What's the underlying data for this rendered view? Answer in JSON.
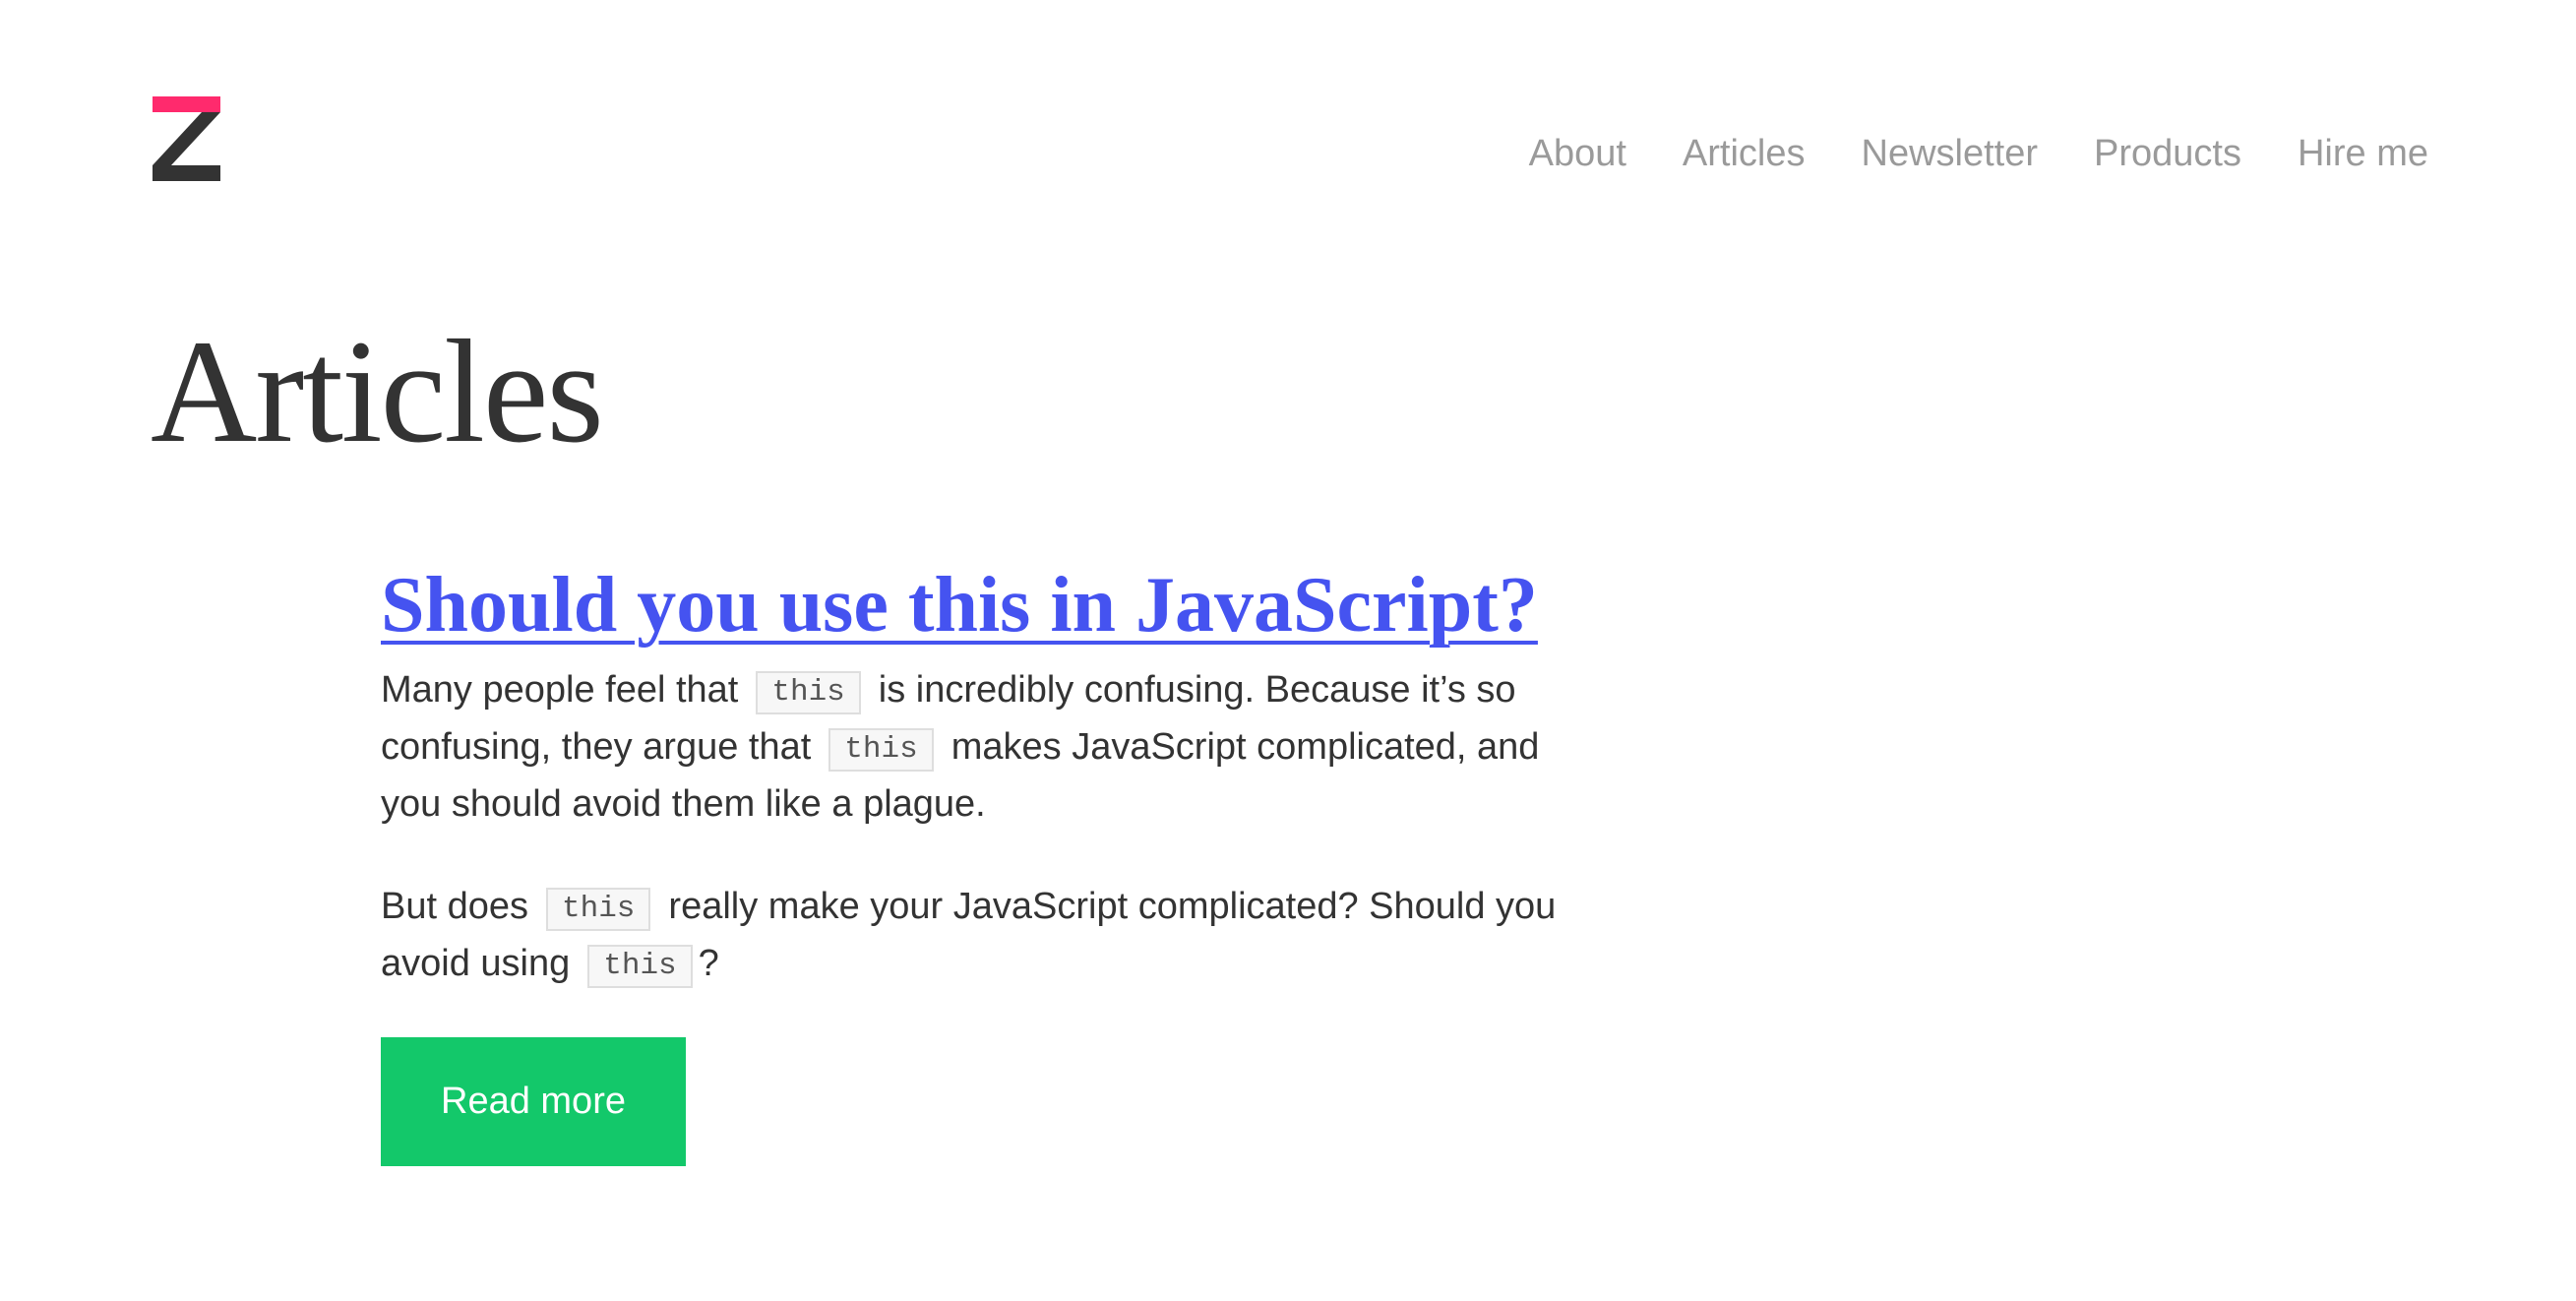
{
  "brand": {
    "logo_icon": "z-logo-icon",
    "logo_accent_color": "#ff2a6d",
    "logo_color": "#333333"
  },
  "nav": {
    "items": [
      {
        "label": "About"
      },
      {
        "label": "Articles"
      },
      {
        "label": "Newsletter"
      },
      {
        "label": "Products"
      },
      {
        "label": "Hire me"
      }
    ],
    "color": "#9a9a9a"
  },
  "page": {
    "title": "Articles"
  },
  "articles": [
    {
      "title": "Should you use this in JavaScript?",
      "title_color": "#4553f0",
      "excerpt_1": {
        "a": "Many people feel that",
        "code_1": "this",
        "b": "is incredibly confusing. Because it’s so",
        "c": "confusing, they argue that",
        "code_2": "this",
        "d": "makes JavaScript complicated, and",
        "e": "you should avoid them like a plague."
      },
      "excerpt_2": {
        "a": "But does",
        "code_1": "this",
        "b": "really make your JavaScript complicated? Should you",
        "c": "avoid using",
        "code_2": "this",
        "d": "?"
      },
      "read_more_label": "Read more",
      "button_color": "#13c86a"
    }
  ]
}
